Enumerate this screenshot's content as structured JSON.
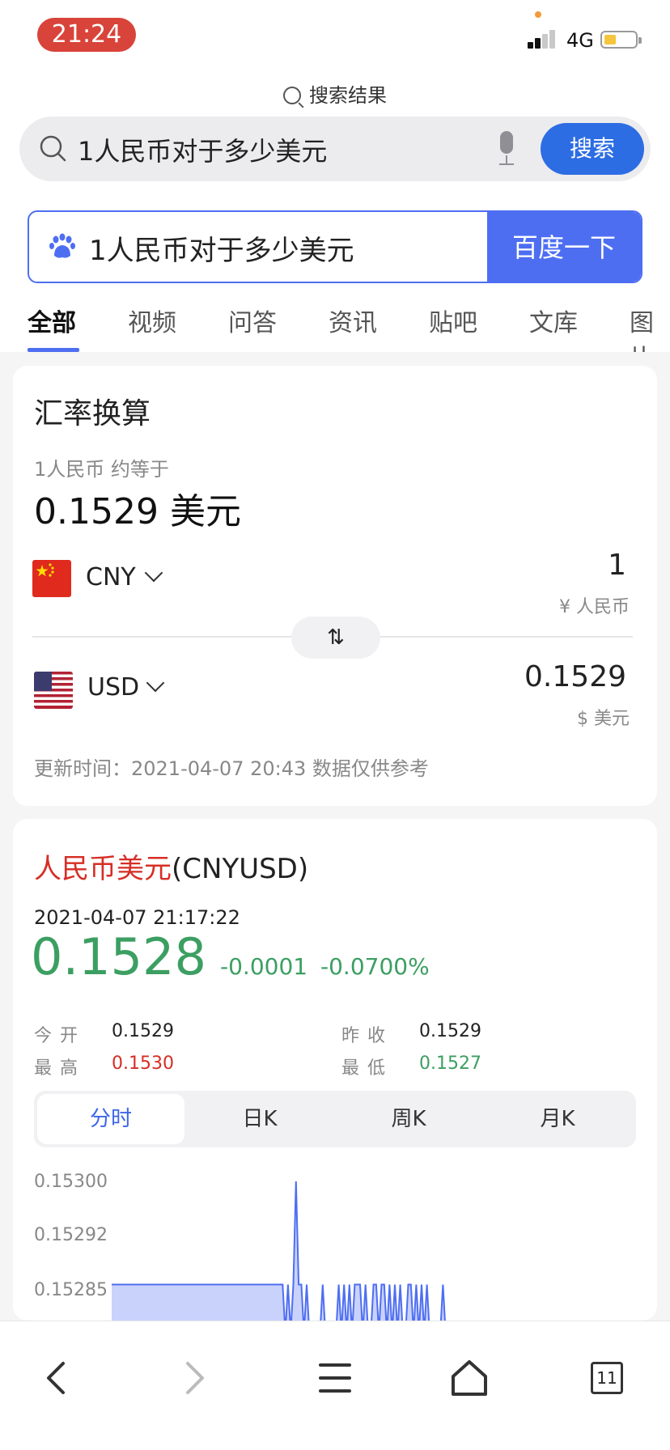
{
  "status_bar": {
    "time": "21:24",
    "network": "4G",
    "colors": {
      "time_pill": "#d8433a",
      "battery_fill": "#f5c53d"
    }
  },
  "header": {
    "results_label": "搜索结果",
    "search_query": "1人民币对于多少美元",
    "search_button": "搜索",
    "baidu_query": "1人民币对于多少美元",
    "baidu_button": "百度一下"
  },
  "tabs": [
    {
      "label": "全部",
      "active": true
    },
    {
      "label": "视频",
      "active": false
    },
    {
      "label": "问答",
      "active": false
    },
    {
      "label": "资讯",
      "active": false
    },
    {
      "label": "贴吧",
      "active": false
    },
    {
      "label": "文库",
      "active": false
    },
    {
      "label": "图片",
      "active": false
    }
  ],
  "converter": {
    "title": "汇率换算",
    "subtitle": "1人民币 约等于",
    "result": "0.1529 美元",
    "from": {
      "code": "CNY",
      "amount": "1",
      "unit": "¥ 人民币"
    },
    "to": {
      "code": "USD",
      "amount": "0.1529",
      "unit": "$ 美元"
    },
    "swap_icon": "⇅",
    "update": "更新时间：2021-04-07 20:43 数据仅供参考"
  },
  "quote": {
    "title_cn": "人民币美元",
    "title_code": "(CNYUSD)",
    "datetime": "2021-04-07 21:17:22",
    "price": "0.1528",
    "change": "-0.0001",
    "change_pct": "-0.0700%",
    "open_label": "今开",
    "open": "0.1529",
    "prev_close_label": "昨收",
    "prev_close": "0.1529",
    "high_label": "最高",
    "high": "0.1530",
    "low_label": "最低",
    "low": "0.1527",
    "periods": [
      "分时",
      "日K",
      "周K",
      "月K"
    ],
    "active_period": "分时",
    "colors": {
      "down": "#3c9f62",
      "up": "#d62e25",
      "line": "#4e6ef2"
    }
  },
  "chart_data": {
    "type": "area",
    "ytick_labels": [
      "0.15300",
      "0.15292",
      "0.15285"
    ],
    "ylim": [
      0.15276,
      0.153
    ],
    "series": [
      {
        "values": [
          0.15285,
          0.15285,
          0.15285,
          0.15285,
          0.15285,
          0.15285,
          0.15285,
          0.15285,
          0.15285,
          0.15285,
          0.15285,
          0.15285,
          0.15285,
          0.15285,
          0.15285,
          0.15285,
          0.15285,
          0.15285,
          0.15285,
          0.15285,
          0.15285,
          0.15285,
          0.15285,
          0.15285,
          0.15285,
          0.15285,
          0.15285,
          0.15285,
          0.15285,
          0.15285,
          0.15285,
          0.15285,
          0.15285,
          0.15285,
          0.15285,
          0.15285,
          0.15285,
          0.15285,
          0.15285,
          0.15285,
          0.15285,
          0.15285,
          0.15285,
          0.15285,
          0.15285,
          0.15285,
          0.15285,
          0.15285,
          0.15285,
          0.15285,
          0.15285,
          0.15285,
          0.15285,
          0.15285,
          0.15285,
          0.15285,
          0.15285,
          0.15285,
          0.15285,
          0.15285,
          0.15285,
          0.15285,
          0.15285,
          0.15285,
          0.15285,
          0.15278,
          0.15285,
          0.15278,
          0.15285,
          0.153,
          0.15285,
          0.15285,
          0.15278,
          0.15285,
          0.15278,
          0.15278,
          0.15278,
          0.15278,
          0.15278,
          0.15285,
          0.15278,
          0.15278,
          0.15278,
          0.15278,
          0.15278,
          0.15285,
          0.15278,
          0.15285,
          0.15278,
          0.15285,
          0.15278,
          0.15285,
          0.15285,
          0.15285,
          0.15278,
          0.15285,
          0.15278,
          0.15278,
          0.15285,
          0.15285,
          0.15278,
          0.15285,
          0.15285,
          0.15278,
          0.15285,
          0.15278,
          0.15285,
          0.15278,
          0.15285,
          0.15278,
          0.15278,
          0.15285,
          0.15285,
          0.15278,
          0.15285,
          0.15278,
          0.15285,
          0.15278,
          0.15285,
          0.15278,
          0.15278,
          0.15278,
          0.15278,
          0.15278,
          0.15285,
          0.15278,
          0.15278
        ]
      }
    ],
    "grid": false,
    "legend": "none"
  },
  "bottom_nav": {
    "tab_count": "11",
    "icons": [
      "back-icon",
      "forward-icon",
      "menu-icon",
      "home-icon",
      "tabs-icon"
    ]
  }
}
